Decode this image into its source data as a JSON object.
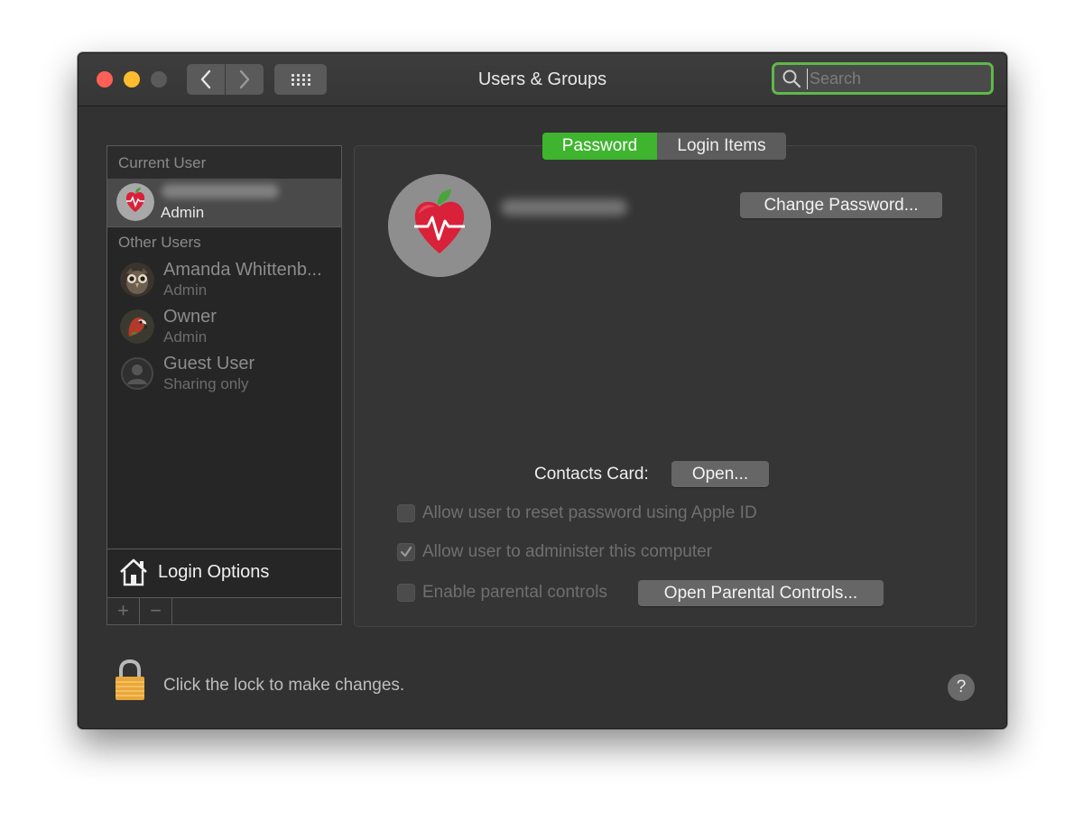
{
  "window": {
    "title": "Users & Groups"
  },
  "search": {
    "placeholder": "Search"
  },
  "sidebar": {
    "current_user_header": "Current User",
    "current_user_role": "Admin",
    "other_users_header": "Other Users",
    "other_users": [
      {
        "name": "Amanda Whittenb...",
        "role": "Admin",
        "avatar": "owl-avatar"
      },
      {
        "name": "Owner",
        "role": "Admin",
        "avatar": "parrot-avatar"
      },
      {
        "name": "Guest User",
        "role": "Sharing only",
        "avatar": "guest-avatar"
      }
    ],
    "login_options": "Login Options",
    "add_label": "+",
    "remove_label": "−"
  },
  "tabs": [
    {
      "label": "Password",
      "selected": true
    },
    {
      "label": "Login Items",
      "selected": false
    }
  ],
  "panel": {
    "change_password": "Change Password...",
    "contacts_card_label": "Contacts Card:",
    "open_button": "Open...",
    "options": [
      {
        "label": "Allow user to reset password using Apple ID",
        "checked": false
      },
      {
        "label": "Allow user to administer this computer",
        "checked": true
      },
      {
        "label": "Enable parental controls",
        "checked": false
      }
    ],
    "open_parental": "Open Parental Controls..."
  },
  "footer": {
    "lock_text": "Click the lock to make changes.",
    "help": "?"
  },
  "colors": {
    "accent_green": "#3fb42f",
    "search_focus": "#5fb84a",
    "close": "#fe5f57",
    "minimize": "#febc2e",
    "apple_red": "#d9213a"
  }
}
